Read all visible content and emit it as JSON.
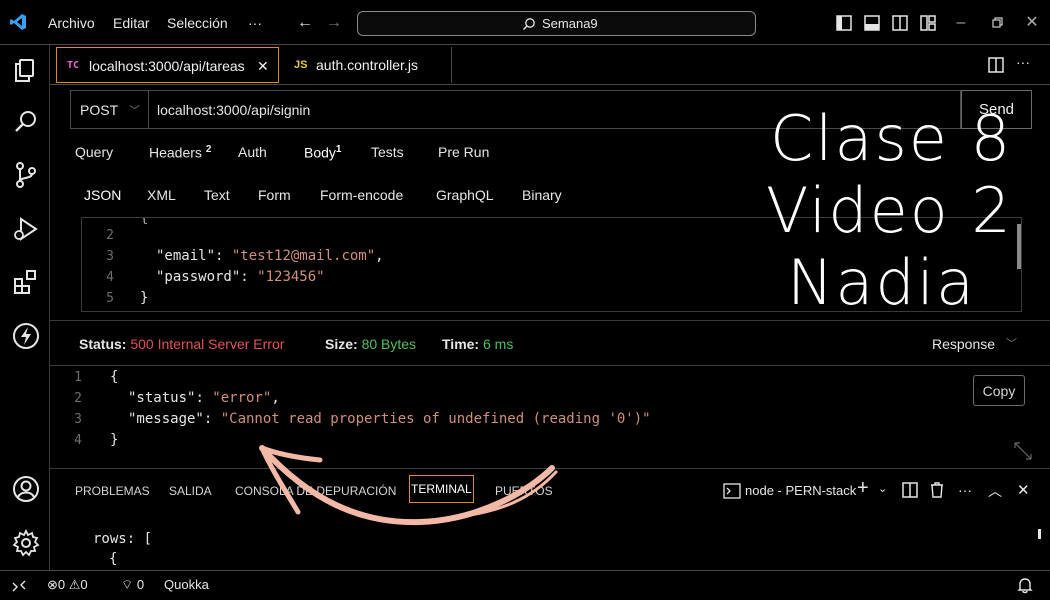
{
  "titlebar": {
    "menu": [
      "Archivo",
      "Editar",
      "Selección",
      "···"
    ],
    "search_label": "Semana9"
  },
  "tabs": [
    {
      "badge": "TC",
      "label": "localhost:3000/api/tareas",
      "close": "✕"
    },
    {
      "badge": "JS",
      "label": "auth.controller.js"
    }
  ],
  "tab_actions": {
    "more": "···"
  },
  "request": {
    "method": "POST",
    "url": "localhost:3000/api/signin",
    "send_label": "Send",
    "tabs": [
      {
        "label": "Query"
      },
      {
        "label": "Headers",
        "count": "2"
      },
      {
        "label": "Auth"
      },
      {
        "label": "Body",
        "count": "1"
      },
      {
        "label": "Tests"
      },
      {
        "label": "Pre Run"
      }
    ],
    "body_types": [
      "JSON",
      "XML",
      "Text",
      "Form",
      "Form-encode",
      "GraphQL",
      "Binary"
    ]
  },
  "body_editor": {
    "lines": [
      {
        "n": "2",
        "text": ""
      },
      {
        "n": "3",
        "key": "\"email\"",
        "value": "\"test12@mail.com\"",
        "trail": ","
      },
      {
        "n": "4",
        "key": "\"password\"",
        "value": "\"123456\"",
        "trail": ""
      },
      {
        "n": "5",
        "text": "}"
      }
    ]
  },
  "response": {
    "status_label": "Status:",
    "status_value": "500 Internal Server Error",
    "size_label": "Size:",
    "size_value": "80 Bytes",
    "time_label": "Time:",
    "time_value": "6 ms",
    "response_dropdown": "Response",
    "copy_label": "Copy",
    "lines": [
      {
        "n": "1",
        "text": "{"
      },
      {
        "n": "2",
        "key": "\"status\"",
        "value": "\"error\"",
        "trail": ","
      },
      {
        "n": "3",
        "key": "\"message\"",
        "value": "\"Cannot read properties of undefined (reading '0')\"",
        "trail": ""
      },
      {
        "n": "4",
        "text": "}"
      }
    ]
  },
  "panel": {
    "tabs": [
      "PROBLEMAS",
      "SALIDA",
      "CONSOLA DE DEPURACIÓN",
      "TERMINAL",
      "PUERTOS"
    ],
    "terminal_name": "node - PERN-stack",
    "content": [
      "rows: [",
      "{"
    ]
  },
  "statusbar": {
    "errors": "0",
    "warnings": "0",
    "ports": "0",
    "quokka": "Quokka"
  },
  "overlay": {
    "line1": "Clase 8",
    "line2": "Video 2",
    "line3": "Nadia"
  },
  "colors": {
    "error": "#e05252",
    "success": "#4fc05a",
    "string": "#ce9178",
    "accent_orange": "#e38a1a",
    "arrow": "#f3b9a6"
  }
}
